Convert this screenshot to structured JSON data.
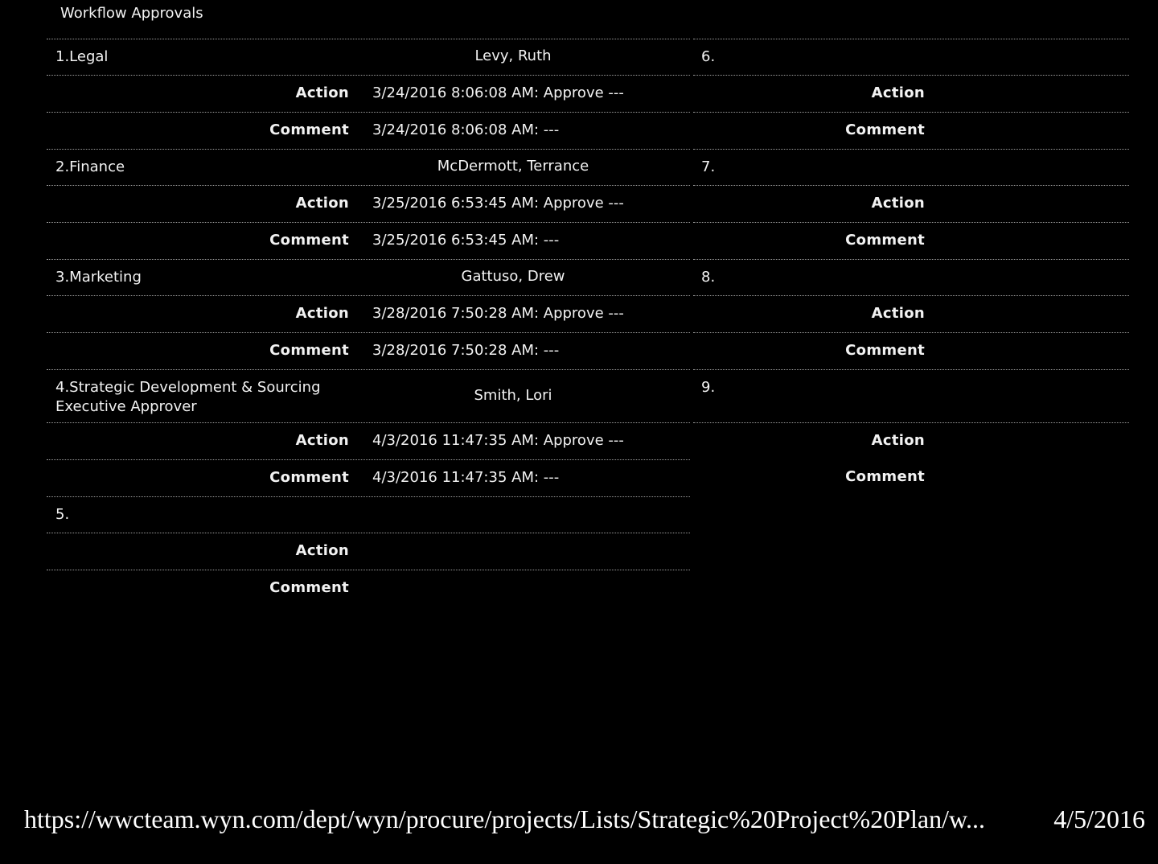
{
  "section_title": "Workflow Approvals",
  "labels": {
    "action": "Action",
    "comment": "Comment"
  },
  "left_steps": [
    {
      "step": "1.Legal",
      "approver": "Levy, Ruth",
      "action": "3/24/2016 8:06:08 AM: Approve ---",
      "comment": "3/24/2016 8:06:08 AM: ---"
    },
    {
      "step": "2.Finance",
      "approver": "McDermott, Terrance",
      "action": "3/25/2016 6:53:45 AM: Approve ---",
      "comment": "3/25/2016 6:53:45 AM: ---"
    },
    {
      "step": "3.Marketing",
      "approver": "Gattuso, Drew",
      "action": "3/28/2016 7:50:28 AM: Approve ---",
      "comment": "3/28/2016 7:50:28 AM: ---"
    },
    {
      "step": "4.Strategic Development & Sourcing\nExecutive Approver",
      "approver": "Smith, Lori",
      "action": "4/3/2016 11:47:35 AM: Approve ---",
      "comment": "4/3/2016 11:47:35 AM: ---"
    },
    {
      "step": "5.",
      "approver": "",
      "action": "",
      "comment": ""
    }
  ],
  "right_steps": [
    {
      "step": "6."
    },
    {
      "step": "7."
    },
    {
      "step": "8."
    },
    {
      "step": "9."
    }
  ],
  "footer": {
    "url": "https://wwcteam.wyn.com/dept/wyn/procure/projects/Lists/Strategic%20Project%20Plan/w...",
    "date": "4/5/2016"
  }
}
